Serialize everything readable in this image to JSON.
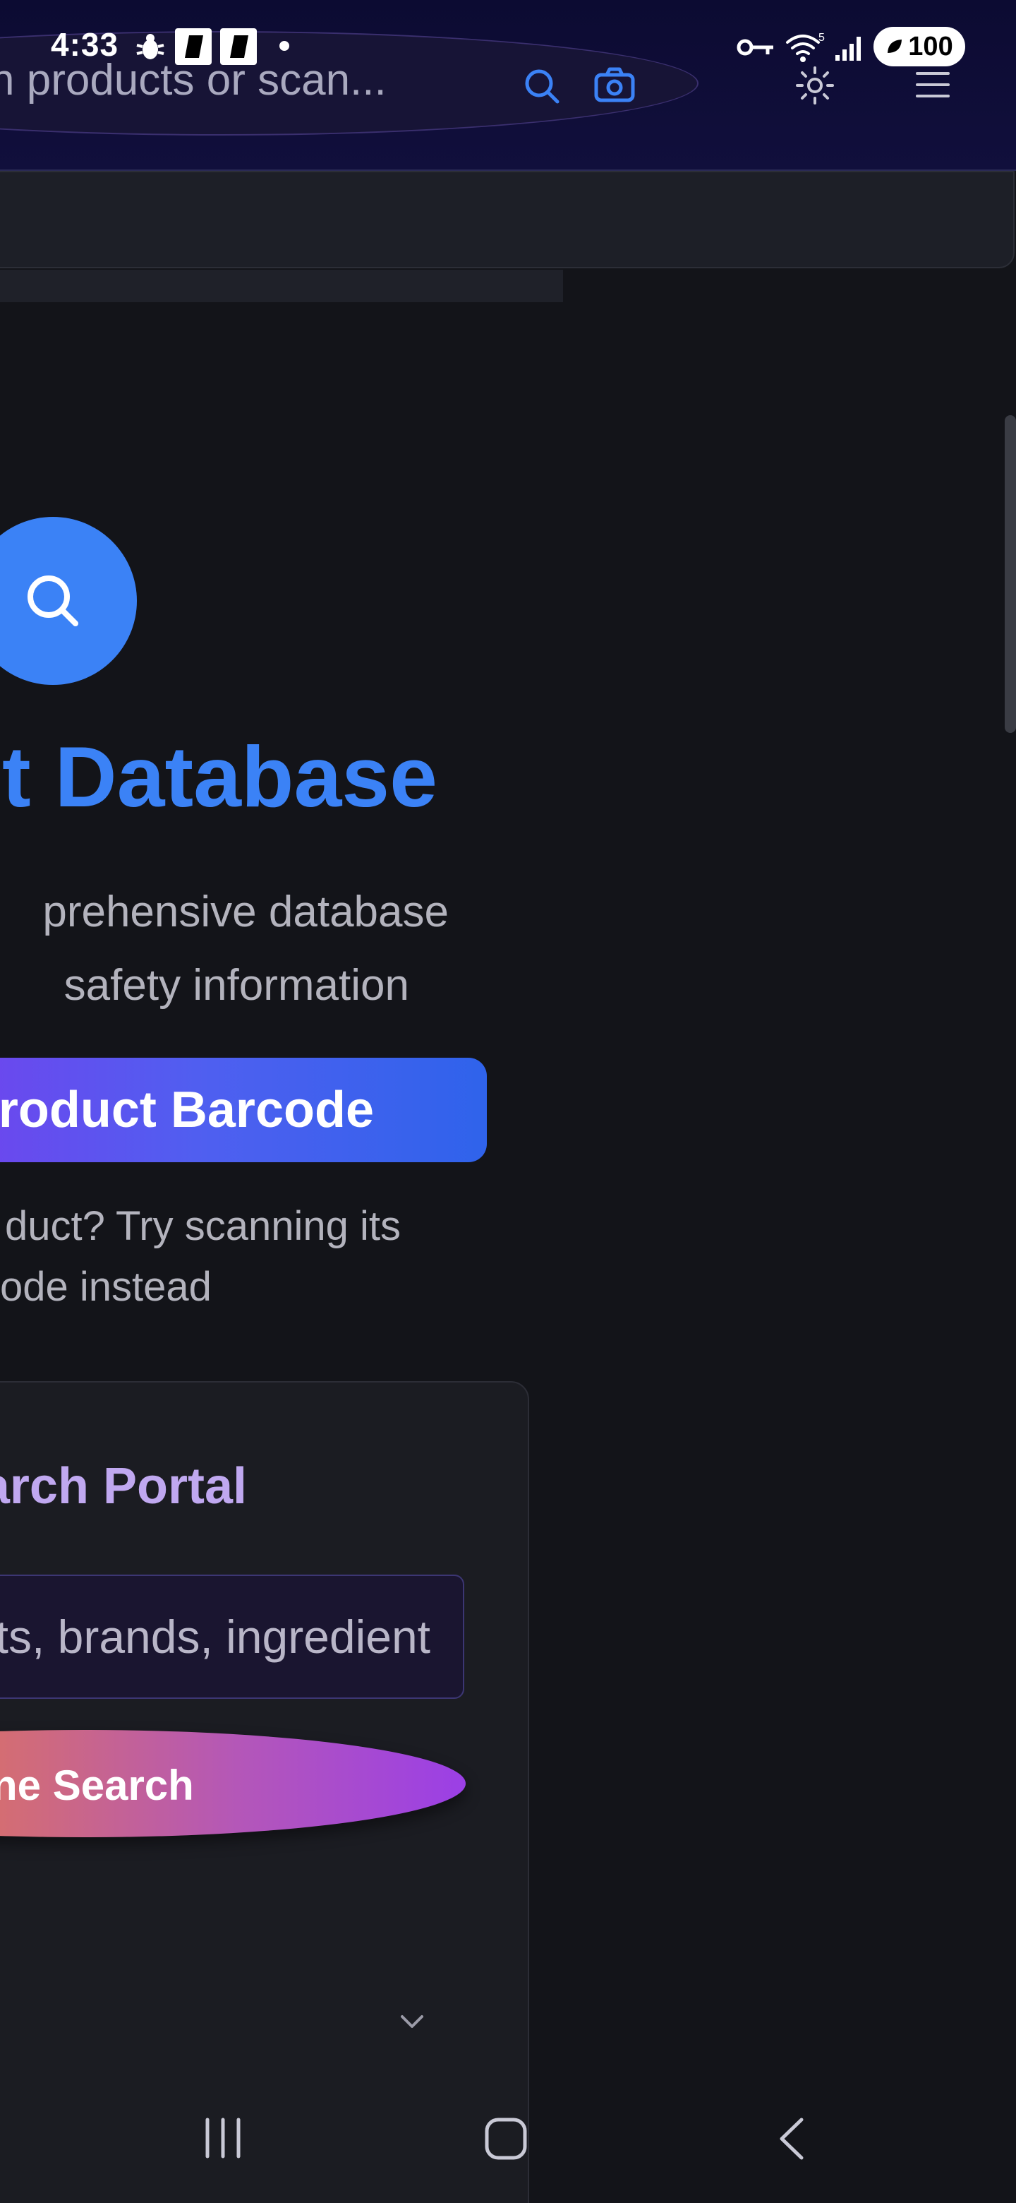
{
  "status_bar": {
    "time": "4:33",
    "battery_level": "100",
    "signal_label": "5"
  },
  "header": {
    "search_placeholder": "n products or scan...",
    "search_icon": "search-icon",
    "camera_icon": "camera-icon",
    "theme_icon": "sun-icon",
    "menu_icon": "menu-icon"
  },
  "hero": {
    "icon": "search-icon",
    "title": "t Database",
    "subtitle_line1": "prehensive database",
    "subtitle_line2": "safety information",
    "scan_button": "roduct Barcode",
    "hint_line1": "duct? Try scanning its",
    "hint_line2": "ode instead"
  },
  "portal": {
    "title": "arch Portal",
    "input_placeholder": "ts, brands, ingredient",
    "search_button": "ne Search",
    "expand_icon": "chevron-down-icon"
  },
  "nav": {
    "recent_icon": "recent-apps-icon",
    "home_icon": "home-icon",
    "back_icon": "back-icon"
  },
  "colors": {
    "accent_blue": "#3b82f6",
    "portal_title": "#c0a8f0",
    "background": "#131419"
  }
}
